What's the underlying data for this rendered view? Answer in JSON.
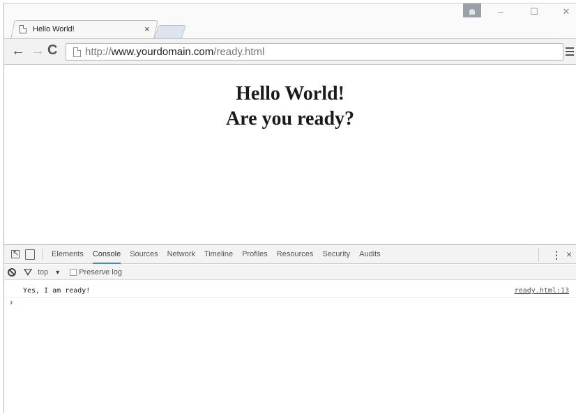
{
  "tab": {
    "title": "Hello World!",
    "close_glyph": "×"
  },
  "window_controls": {
    "minimize": "–",
    "maximize": "☐",
    "close": "✕"
  },
  "toolbar": {
    "back_glyph": "←",
    "forward_glyph": "→",
    "reload_glyph": "C",
    "url_prefix": "http://",
    "url_host": "www.yourdomain.com",
    "url_path": "/ready.html"
  },
  "page": {
    "heading_line1": "Hello World!",
    "heading_line2": "Are you ready?"
  },
  "devtools": {
    "tabs": [
      "Elements",
      "Console",
      "Sources",
      "Network",
      "Timeline",
      "Profiles",
      "Resources",
      "Security",
      "Audits"
    ],
    "active_tab": "Console",
    "more_glyph": "⋮",
    "close_glyph": "×",
    "context": "top",
    "context_arrow": "▼",
    "preserve_log_label": "Preserve log",
    "log_message": "Yes, I am ready!",
    "log_source": "ready.html:13",
    "prompt_glyph": "›"
  },
  "colors": {
    "accent": "#3e82f7",
    "devtools_bg": "#f3f3f3"
  },
  "icons": [
    "page-icon",
    "close-icon",
    "user-icon",
    "back-icon",
    "forward-icon",
    "reload-icon",
    "menu-icon",
    "inspect-icon",
    "device-icon",
    "clear-console-icon",
    "filter-icon"
  ]
}
